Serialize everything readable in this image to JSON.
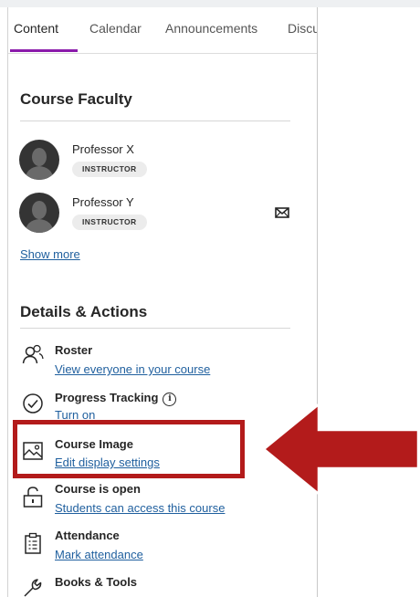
{
  "tabs": [
    {
      "label": "Content",
      "active": true
    },
    {
      "label": "Calendar",
      "active": false
    },
    {
      "label": "Announcements",
      "active": false
    },
    {
      "label": "Discu",
      "active": false
    }
  ],
  "faculty": {
    "heading": "Course Faculty",
    "members": [
      {
        "name": "Professor X",
        "role": "INSTRUCTOR",
        "has_mail_icon": false
      },
      {
        "name": "Professor Y",
        "role": "INSTRUCTOR",
        "has_mail_icon": true
      }
    ],
    "show_more": "Show more"
  },
  "details": {
    "heading": "Details & Actions",
    "items": [
      {
        "title": "Roster",
        "link": "View everyone in your course",
        "icon": "roster-icon"
      },
      {
        "title": "Progress Tracking",
        "link": "Turn on",
        "icon": "progress-check-icon",
        "info_glyph": "i"
      },
      {
        "title": "Course Image",
        "link": "Edit display settings",
        "icon": "image-icon"
      },
      {
        "title": "Course is open",
        "link": "Students can access this course",
        "icon": "unlock-icon"
      },
      {
        "title": "Attendance",
        "link": "Mark attendance",
        "icon": "clipboard-icon"
      },
      {
        "title": "Books & Tools",
        "link": "",
        "icon": "wrench-icon"
      }
    ]
  },
  "colors": {
    "tab_accent": "#8b1bab",
    "link": "#1f5f9e",
    "annotation_red": "#b31b1b"
  }
}
